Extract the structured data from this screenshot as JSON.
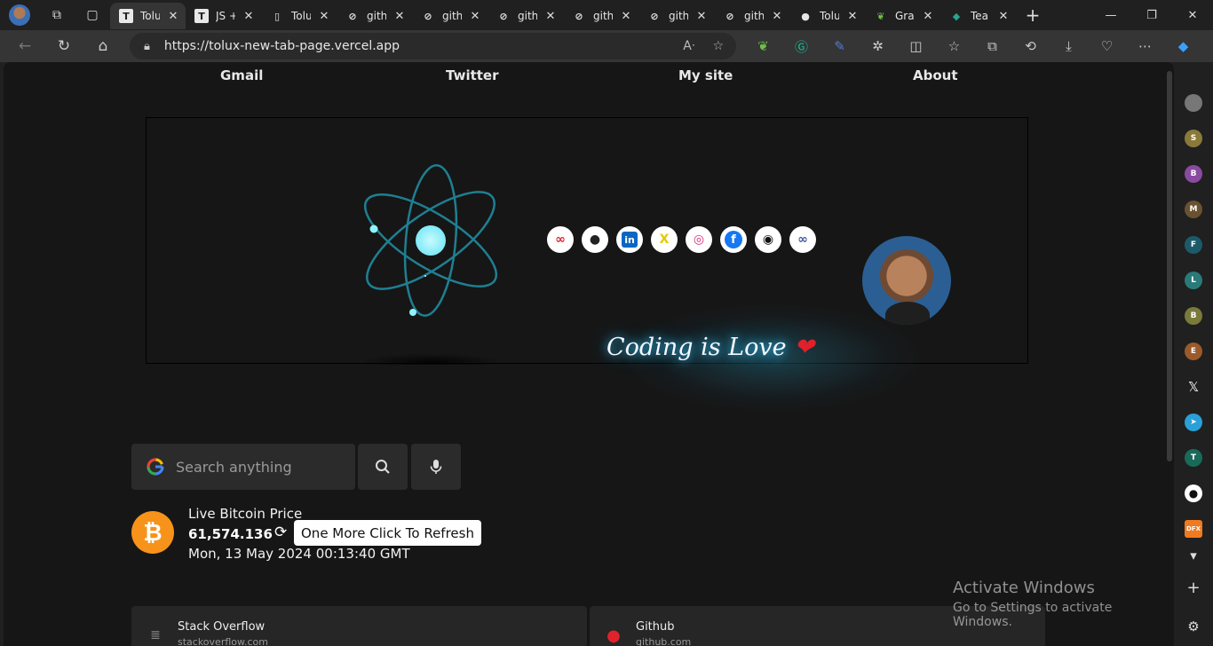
{
  "browser": {
    "tabs": [
      {
        "label": "Tolu",
        "icon": "t-letter-icon",
        "active": true
      },
      {
        "label": "JS +",
        "icon": "t-letter-icon"
      },
      {
        "label": "Tolu",
        "icon": "page-icon"
      },
      {
        "label": "gith",
        "icon": "github-link-icon"
      },
      {
        "label": "gith",
        "icon": "github-link-icon"
      },
      {
        "label": "gith",
        "icon": "github-link-icon"
      },
      {
        "label": "gith",
        "icon": "github-link-icon"
      },
      {
        "label": "gith",
        "icon": "github-link-icon"
      },
      {
        "label": "gith",
        "icon": "github-link-icon"
      },
      {
        "label": "Tolu",
        "icon": "github-icon"
      },
      {
        "label": "Gra",
        "icon": "leaf-icon"
      },
      {
        "label": "Tea",
        "icon": "diamond-icon"
      }
    ],
    "url": "https://tolux-new-tab-page.vercel.app"
  },
  "nav": {
    "links": [
      "Gmail",
      "Twitter",
      "My site",
      "About"
    ]
  },
  "hero": {
    "tagline": "Coding is Love",
    "socials": [
      "link-icon",
      "github-icon",
      "linkedin-icon",
      "x-icon",
      "instagram-icon",
      "facebook-icon",
      "circle-dot-icon",
      "chain-icon"
    ]
  },
  "search": {
    "placeholder": "Search anything"
  },
  "bitcoin": {
    "title": "Live Bitcoin Price",
    "price": "61,574.136",
    "tooltip": "One More Click To Refresh",
    "date": "Mon, 13 May 2024 00:13:40 GMT"
  },
  "bookmarks": [
    {
      "title": "Stack Overflow",
      "url": "stackoverflow.com",
      "icon": "stackoverflow-icon"
    },
    {
      "title": "Github",
      "url": "github.com",
      "icon": "github-icon"
    }
  ],
  "watermark": {
    "line1": "Activate Windows",
    "line2": "Go to Settings to activate Windows."
  },
  "sidebar": {
    "letters": [
      "S",
      "B",
      "M",
      "F",
      "L",
      "B",
      "E",
      "T"
    ],
    "dfx": "DFX"
  },
  "colors": {
    "bitcoin": "#f7931a",
    "glow": "#37c6ff",
    "atom": "#8ef4ff"
  }
}
